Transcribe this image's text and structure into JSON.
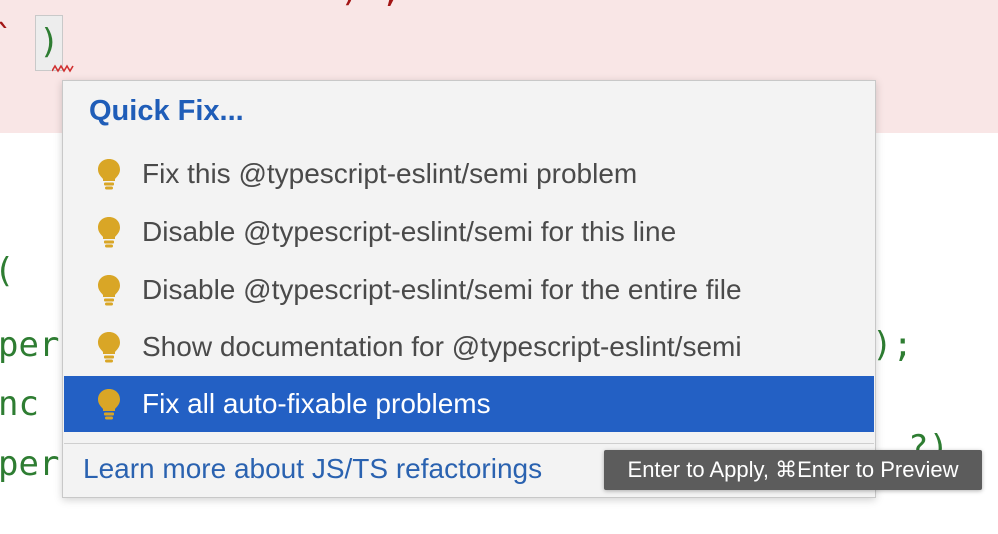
{
  "editor": {
    "top_fragment": ") ,",
    "left_fragment": "`",
    "paren": ")",
    "side_lines": [
      "(",
      "per",
      "nc",
      "per"
    ],
    "right_fragment_1": ");",
    "right_fragment_2": "?)",
    "colors": {
      "code_green": "#2e7d32",
      "error_band": "#f9e6e6",
      "squiggle": "#d03030"
    }
  },
  "quick_fix": {
    "title": "Quick Fix...",
    "items": [
      {
        "label": "Fix this @typescript-eslint/semi problem",
        "icon": "lightbulb-icon",
        "selected": false
      },
      {
        "label": "Disable @typescript-eslint/semi for this line",
        "icon": "lightbulb-icon",
        "selected": false
      },
      {
        "label": "Disable @typescript-eslint/semi for the entire file",
        "icon": "lightbulb-icon",
        "selected": false
      },
      {
        "label": "Show documentation for @typescript-eslint/semi",
        "icon": "lightbulb-icon",
        "selected": false
      },
      {
        "label": "Fix all auto-fixable problems",
        "icon": "lightbulb-icon",
        "selected": true
      }
    ],
    "learn_more": "Learn more about JS/TS refactorings",
    "hint": "Enter to Apply, ⌘Enter to Preview",
    "colors": {
      "accent": "#1f5db8",
      "selected_bg": "#2360c4",
      "bulb": "#d9a626"
    }
  }
}
